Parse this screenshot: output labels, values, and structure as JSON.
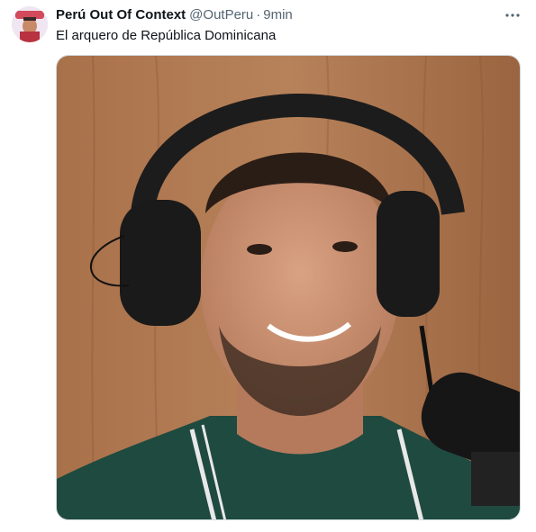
{
  "tweet": {
    "author_name": "Perú Out Of Context",
    "handle": "@OutPeru",
    "separator": "·",
    "time": "9min",
    "text": "El arquero de República Dominicana"
  },
  "icons": {
    "more": "more-horizontal-icon"
  },
  "colors": {
    "text_primary": "#0f1419",
    "text_secondary": "#536471",
    "border": "#cfd9de",
    "background": "#ffffff"
  }
}
